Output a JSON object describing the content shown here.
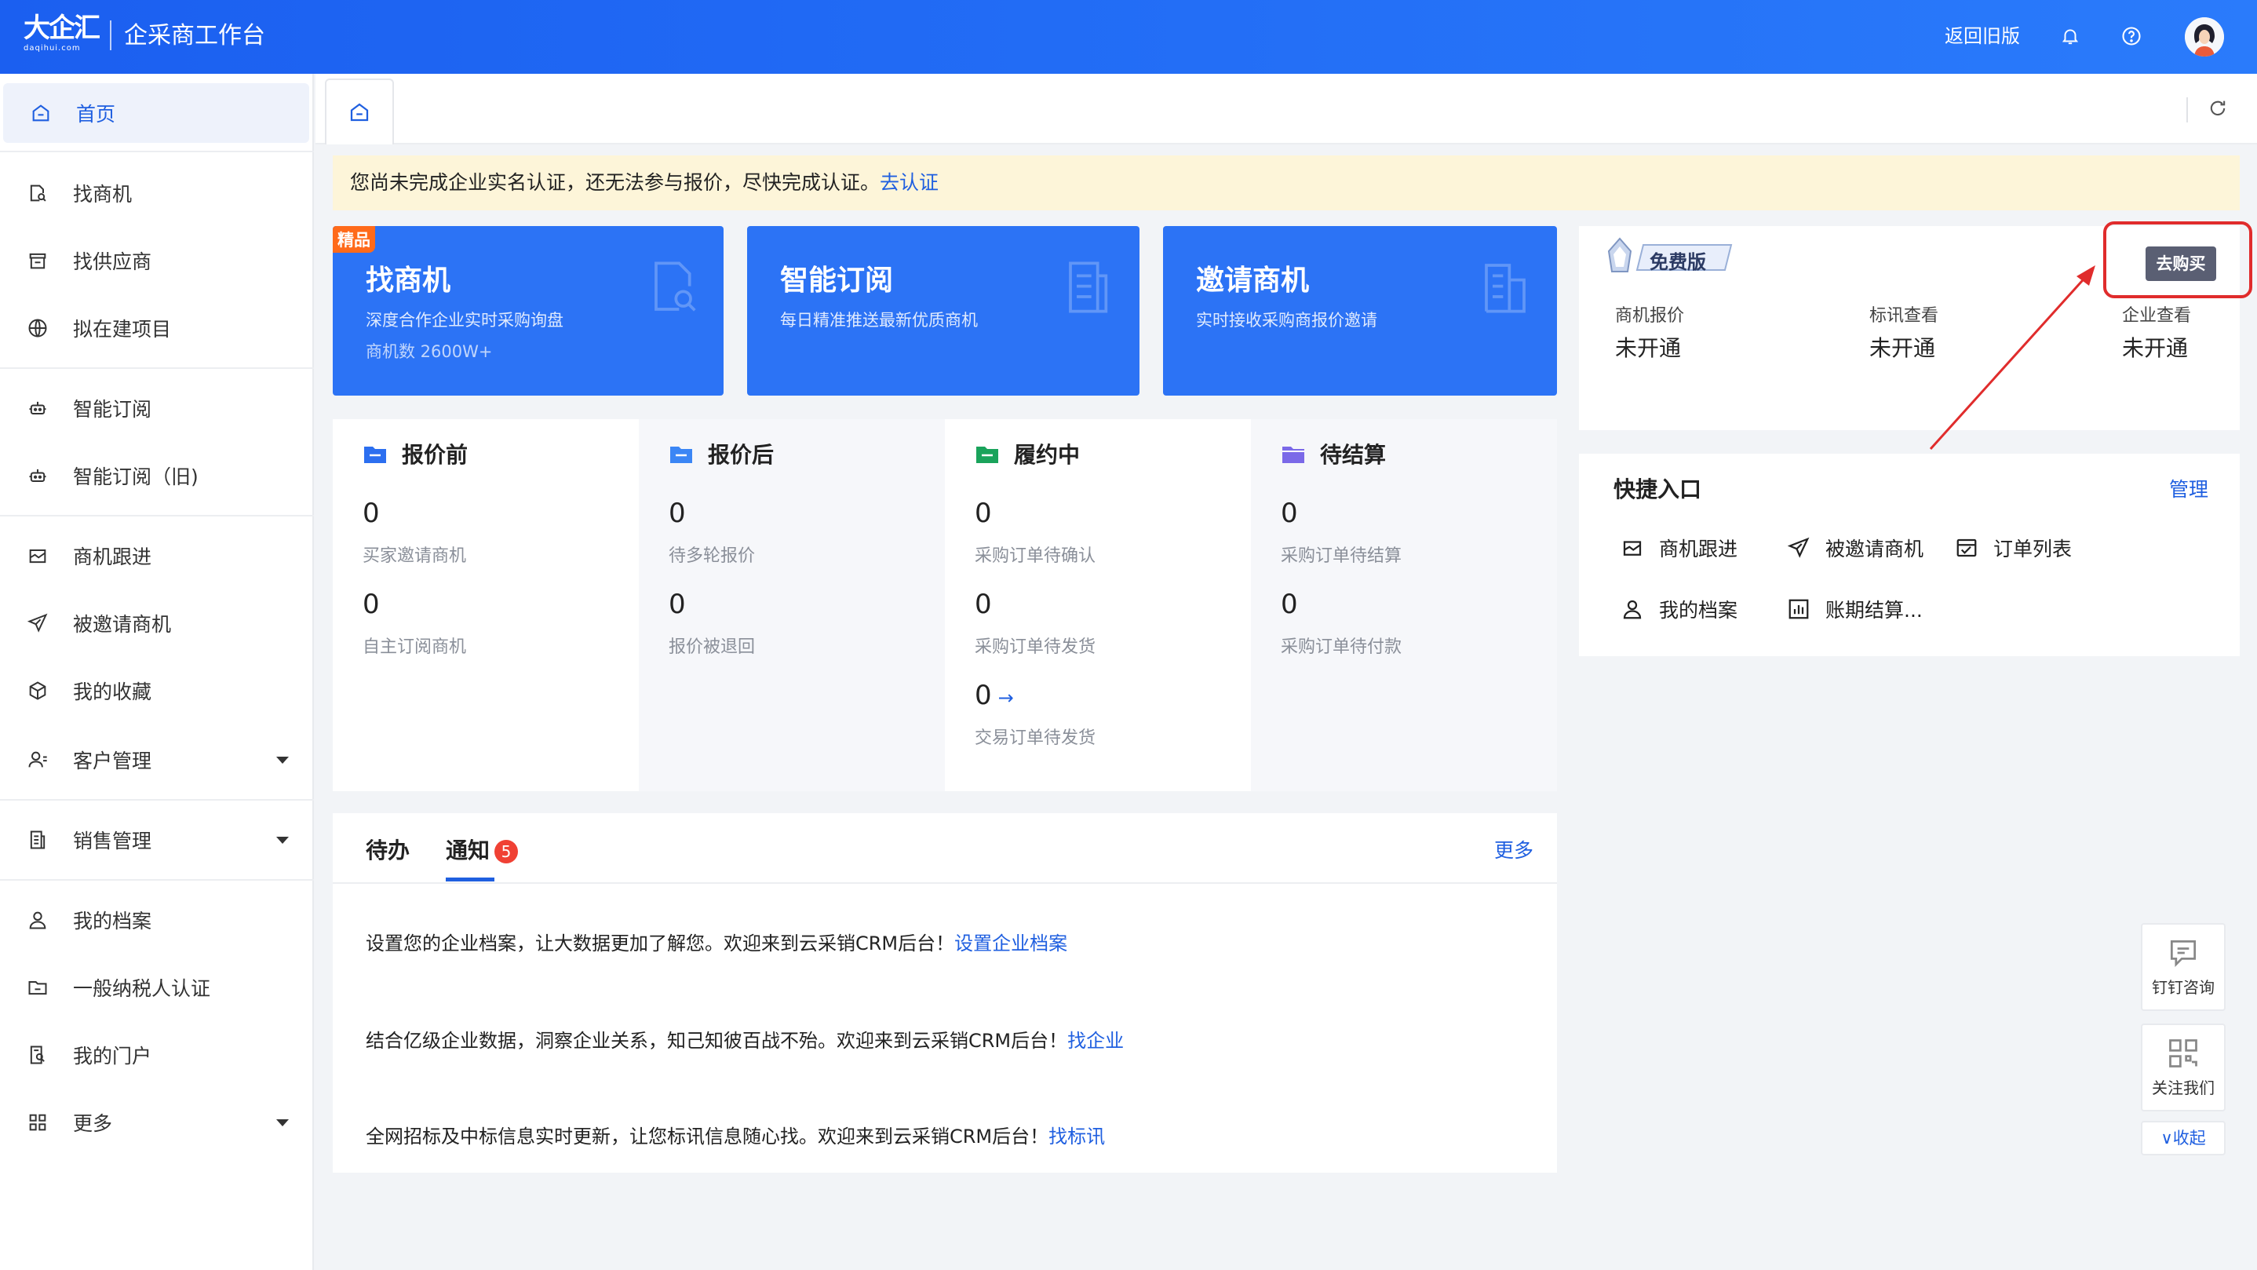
{
  "header": {
    "logo_text": "大企汇",
    "logo_sub": "daqihui.com",
    "title": "企采商工作台",
    "back_old": "返回旧版"
  },
  "sidebar": {
    "items": [
      {
        "label": "首页",
        "icon": "home-icon"
      },
      {
        "label": "找商机",
        "icon": "search-doc-icon"
      },
      {
        "label": "找供应商",
        "icon": "store-icon"
      },
      {
        "label": "拟在建项目",
        "icon": "globe-icon"
      },
      {
        "label": "智能订阅",
        "icon": "robot-icon"
      },
      {
        "label": "智能订阅（旧)",
        "icon": "robot-icon"
      },
      {
        "label": "商机跟进",
        "icon": "follow-icon"
      },
      {
        "label": "被邀请商机",
        "icon": "send-icon"
      },
      {
        "label": "我的收藏",
        "icon": "cube-icon"
      },
      {
        "label": "客户管理",
        "icon": "user-manage-icon"
      },
      {
        "label": "销售管理",
        "icon": "doc-list-icon"
      },
      {
        "label": "我的档案",
        "icon": "user-icon"
      },
      {
        "label": "一般纳税人认证",
        "icon": "folder-icon"
      },
      {
        "label": "我的门户",
        "icon": "portal-icon"
      },
      {
        "label": "更多",
        "icon": "grid-icon"
      }
    ]
  },
  "notice": {
    "text": "您尚未完成企业实名认证，还无法参与报价，尽快完成认证。",
    "link": "去认证"
  },
  "features": [
    {
      "title": "找商机",
      "desc": "深度合作企业实时采购询盘",
      "count": "商机数 2600W+",
      "badge": "精品"
    },
    {
      "title": "智能订阅",
      "desc": "每日精准推送最新优质商机"
    },
    {
      "title": "邀请商机",
      "desc": "实时接收采购商报价邀请"
    }
  ],
  "stats": [
    {
      "title": "报价前",
      "color": "#2c6ff0",
      "items": [
        {
          "value": "0",
          "label": "买家邀请商机"
        },
        {
          "value": "0",
          "label": "自主订阅商机"
        }
      ]
    },
    {
      "title": "报价后",
      "color": "#3b86f5",
      "items": [
        {
          "value": "0",
          "label": "待多轮报价"
        },
        {
          "value": "0",
          "label": "报价被退回"
        }
      ]
    },
    {
      "title": "履约中",
      "color": "#1aa35b",
      "items": [
        {
          "value": "0",
          "label": "采购订单待确认"
        },
        {
          "value": "0",
          "label": "采购订单待发货"
        },
        {
          "value": "0",
          "label": "交易订单待发货"
        }
      ]
    },
    {
      "title": "待结算",
      "color": "#7b69e8",
      "items": [
        {
          "value": "0",
          "label": "采购订单待结算"
        },
        {
          "value": "0",
          "label": "采购订单待付款"
        }
      ]
    }
  ],
  "bottom": {
    "tab_todo": "待办",
    "tab_notice": "通知",
    "notice_count": "5",
    "more": "更多",
    "notices": [
      {
        "text": "设置您的企业档案，让大数据更加了解您。欢迎来到云采销CRM后台！",
        "link": "设置企业档案"
      },
      {
        "text": "结合亿级企业数据，洞察企业关系，知己知彼百战不殆。欢迎来到云采销CRM后台！",
        "link": "找企业"
      },
      {
        "text": "全网招标及中标信息实时更新，让您标讯信息随心找。欢迎来到云采销CRM后台！",
        "link": "找标讯"
      }
    ]
  },
  "version": {
    "badge": "免费版",
    "buy": "去购买",
    "items": [
      {
        "label": "商机报价",
        "value": "未开通"
      },
      {
        "label": "标讯查看",
        "value": "未开通"
      },
      {
        "label": "企业查看",
        "value": "未开通"
      }
    ]
  },
  "quick": {
    "title": "快捷入口",
    "manage": "管理",
    "items": [
      {
        "label": "商机跟进",
        "icon": "follow-icon"
      },
      {
        "label": "被邀请商机",
        "icon": "send-icon"
      },
      {
        "label": "订单列表",
        "icon": "order-list-icon"
      },
      {
        "label": "我的档案",
        "icon": "user-icon"
      },
      {
        "label": "账期结算...",
        "icon": "chart-icon"
      }
    ]
  },
  "float": {
    "dingtalk": "钉钉咨询",
    "follow_us": "关注我们",
    "collapse": "收起"
  }
}
